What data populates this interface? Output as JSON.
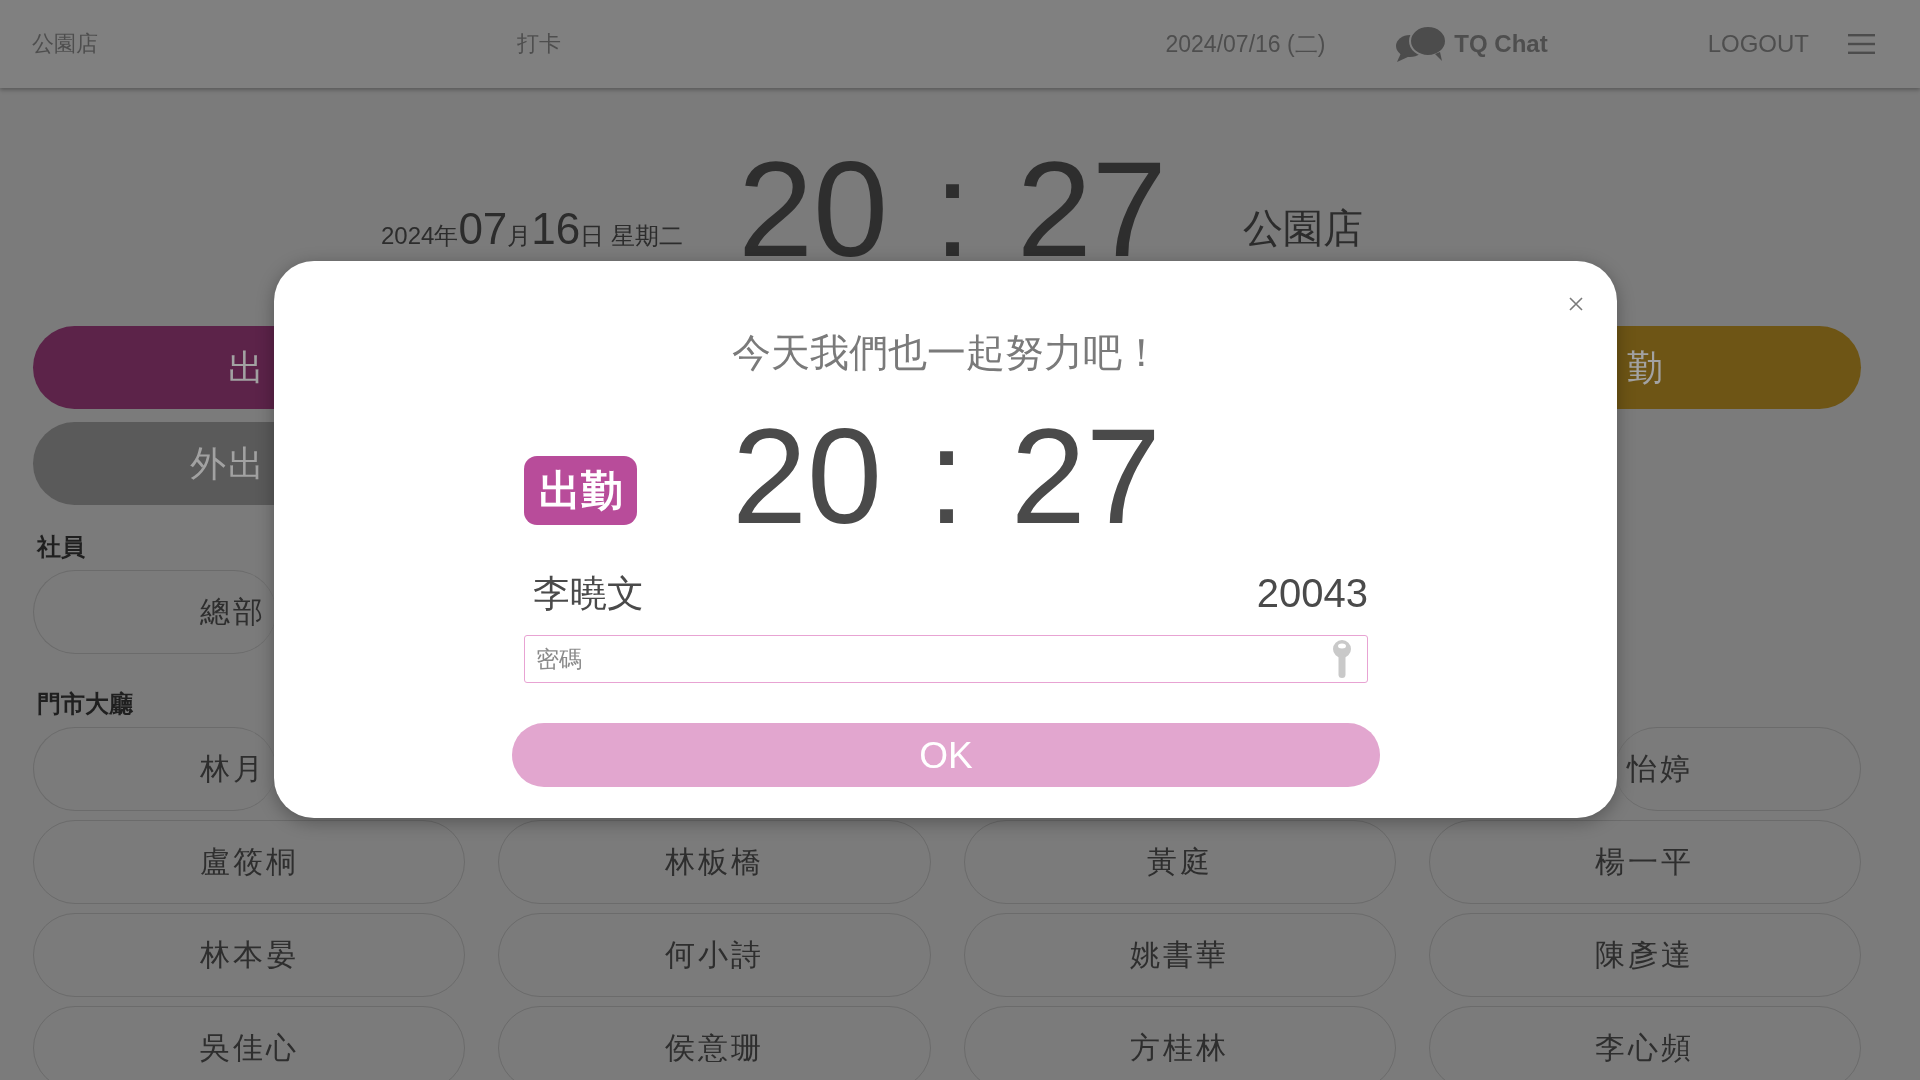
{
  "top_bar": {
    "store": "公園店",
    "title": "打卡",
    "date": "2024/07/16 (二)",
    "chat_label": "TQ Chat",
    "logout": "LOGOUT"
  },
  "clock": {
    "date_parts": [
      {
        "text": "2024年",
        "kind": "unit"
      },
      {
        "text": "07",
        "kind": "number"
      },
      {
        "text": "月",
        "kind": "unit"
      },
      {
        "text": "16",
        "kind": "number"
      },
      {
        "text": "日 星期二",
        "kind": "unit"
      }
    ],
    "time": "20 : 27",
    "store": "公園店"
  },
  "action_rows": [
    {
      "left": {
        "label": "出",
        "color": "#5c2349"
      },
      "right": {
        "label": "勤",
        "color": "#6e5515"
      }
    },
    {
      "left": {
        "label": "外出",
        "color": "#5a5a5a"
      }
    }
  ],
  "sections": [
    {
      "title": "社員",
      "rows": [
        {
          "left": "總部"
        }
      ]
    },
    {
      "title": "門市大廳",
      "rows": [
        {
          "left": "林月",
          "right": "怡婷"
        },
        {
          "cells": [
            "盧筱桐",
            "林板橋",
            "黃庭",
            "楊一平"
          ]
        },
        {
          "cells": [
            "林本晏",
            "何小詩",
            "姚書華",
            "陳彥達"
          ]
        },
        {
          "cells": [
            "吳佳心",
            "侯意珊",
            "方桂林",
            "李心頻"
          ]
        }
      ]
    }
  ],
  "dialog": {
    "message": "今天我們也一起努力吧！",
    "badge": "出勤",
    "time": "20 : 27",
    "employee_name": "李曉文",
    "employee_id": "20043",
    "password": {
      "placeholder": "密碼"
    },
    "ok": "OK"
  }
}
